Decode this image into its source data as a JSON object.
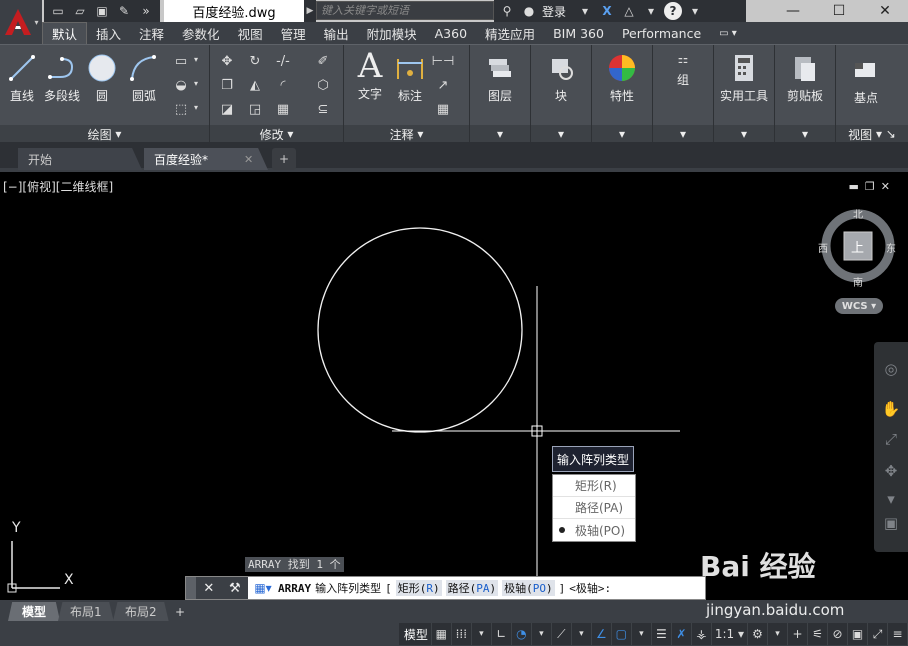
{
  "titlebar": {
    "doc_title": "百度经验.dwg",
    "search_placeholder": "键入关键字或短语",
    "login_label": "登录",
    "minimize": "—",
    "maximize": "☐",
    "close": "✕"
  },
  "ribbon_tabs": [
    "默认",
    "插入",
    "注释",
    "参数化",
    "视图",
    "管理",
    "输出",
    "附加模块",
    "A360",
    "精选应用",
    "BIM 360",
    "Performance"
  ],
  "ribbon": {
    "draw": {
      "title": "绘图",
      "line": "直线",
      "polyline": "多段线",
      "circle": "圆",
      "arc": "圆弧"
    },
    "modify": {
      "title": "修改"
    },
    "annotation": {
      "title": "注释",
      "text": "文字",
      "dimension": "标注"
    },
    "layers": {
      "title": "图层"
    },
    "block": {
      "title": "块"
    },
    "properties": {
      "title": "特性"
    },
    "groups": {
      "title": "组"
    },
    "utilities": {
      "title": "实用工具"
    },
    "clipboard": {
      "title": "剪贴板"
    },
    "view": {
      "title": "视图",
      "base": "基点"
    }
  },
  "doc_tabs": {
    "start": "开始",
    "current": "百度经验*",
    "close": "✕",
    "add": "+"
  },
  "viewport": {
    "label": "[−][俯视][二维线框]",
    "compass": {
      "north": "北",
      "south": "南",
      "east": "东",
      "west": "西",
      "top": "上"
    },
    "wcs": "WCS",
    "ucs_y": "Y",
    "ucs_x": "X"
  },
  "dynamic_input": {
    "prompt": "输入阵列类型",
    "options": [
      {
        "label": "矩形(R)",
        "selected": false
      },
      {
        "label": "路径(PA)",
        "selected": false
      },
      {
        "label": "极轴(PO)",
        "selected": true
      }
    ]
  },
  "command_history": "ARRAY 找到 1 个",
  "command_line": {
    "command": "ARRAY",
    "prompt": "输入阵列类型",
    "open_bracket": "[",
    "opt1_label": "矩形",
    "opt1_key": "R",
    "opt2_label": "路径",
    "opt2_key": "PA",
    "opt3_label": "极轴",
    "opt3_key": "PO",
    "close_bracket": "]",
    "default": "<极轴>:"
  },
  "layout_tabs": {
    "model": "模型",
    "layout1": "布局1",
    "layout2": "布局2",
    "add": "+"
  },
  "statusbar": {
    "model": "模型",
    "scale": "1:1"
  },
  "watermark": {
    "brand": "Bai 经验",
    "url": "jingyan.baidu.com"
  },
  "colors": {
    "ribbon_bg": "#4a4e54",
    "canvas_bg": "#000000",
    "autocad_red": "#c51d20",
    "accent_blue": "#3f8fe6"
  }
}
